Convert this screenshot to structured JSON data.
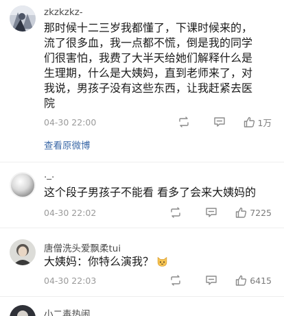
{
  "comments": [
    {
      "username": "zkzkzkz-",
      "text_lines": [
        "那时候十二三岁我都懂了，下课时候来的，",
        "流了很多血，我一点都不慌，倒是我的同学",
        "们很害怕，我费了大半天给她们解释什么是",
        "生理期，什么是大姨妈，直到老师来了，对",
        "我说，男孩子没有这些东西，让我赶紧去医",
        "院"
      ],
      "timestamp": "04-30 22:00",
      "likes": "1万",
      "origin_link": "查看原微博"
    },
    {
      "username": "._.",
      "text": "这个段子男孩子不能看 看多了会来大姨妈的",
      "timestamp": "04-30 22:02",
      "likes": "7225"
    },
    {
      "username": "唐僧洗头爱飘柔tui",
      "text": "大姨妈：你特么演我？",
      "emoji": "cat-face-emoji",
      "timestamp": "04-30 22:03",
      "likes": "6415"
    },
    {
      "username": "小二毒热闹"
    }
  ],
  "icons": {
    "repost": "repost-icon",
    "reply": "comment-icon",
    "like": "thumbs-up-icon"
  },
  "colors": {
    "link": "#3d6aa8",
    "username": "#4a4a4a",
    "text": "#1a1a1a",
    "meta": "#9a9a9a",
    "icon": "#8a8a8a"
  }
}
